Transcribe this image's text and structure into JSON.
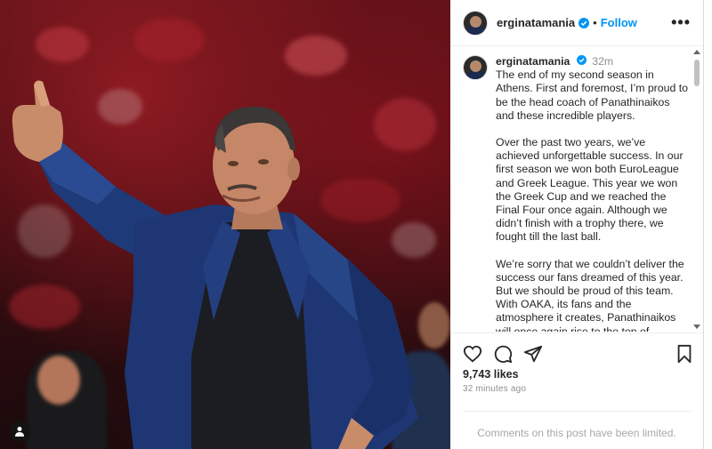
{
  "post": {
    "username": "erginatamania",
    "follow_label": "Follow",
    "more_label": "•••",
    "separator": "•",
    "time_ago_short": "32m",
    "caption_paragraphs": [
      "The end of my second season in Athens. First and foremost, I’m proud to be the head coach of Panathinaikos and these incredible players.",
      "Over the past two years, we’ve achieved unforgettable success. In our first season we won both EuroLeague and Greek League. This year we won the Greek Cup and we reached the Final Four once again. Although we didn’t finish with a trophy there, we fought till the last ball.",
      "We’re sorry that we couldn’t deliver the success our fans dreamed of this year. But we should be proud of this team. With OAKA, its fans and the atmosphere it creates, Panathinaikos will once again rise to the top of European basketball."
    ],
    "likes": "9,743 likes",
    "time_ago_long": "32 minutes ago",
    "comments_limited": "Comments on this post have been limited."
  },
  "icons": {
    "verified": "verified-badge-icon",
    "like": "heart-icon",
    "comment": "comment-icon",
    "share": "share-icon",
    "save": "bookmark-icon",
    "user_tag": "user-tag-icon"
  },
  "colors": {
    "accent": "#0095f6",
    "muted": "#8e8e8e",
    "photo_bg": "#5a1218",
    "jacket": "#1f3a78"
  }
}
